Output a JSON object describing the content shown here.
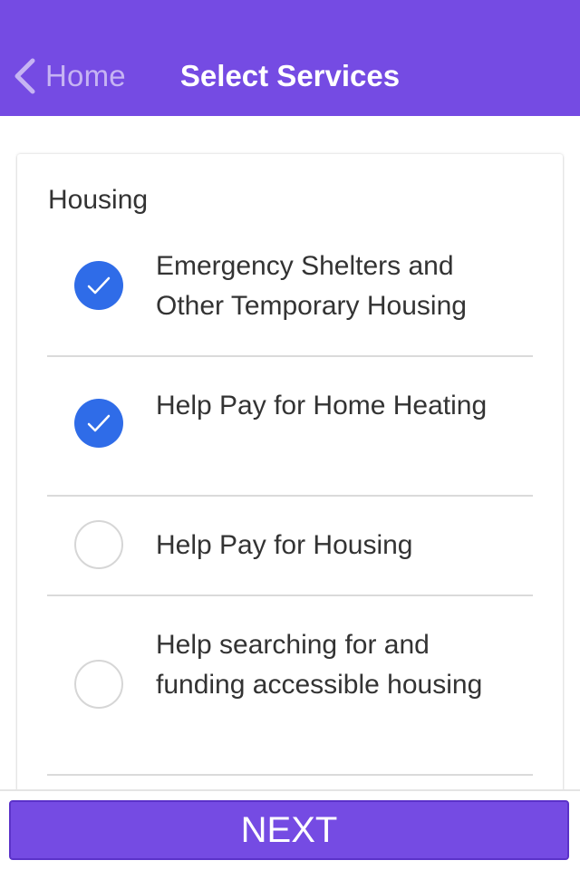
{
  "header": {
    "back_label": "Home",
    "title": "Select Services",
    "back_icon": "chevron-left-icon"
  },
  "section": {
    "title": "Housing",
    "items": [
      {
        "label": "Emergency Shelters and Other Temporary Housing",
        "checked": true
      },
      {
        "label": "Help Pay for Home Heating",
        "checked": true
      },
      {
        "label": "Help Pay for Housing",
        "checked": false
      },
      {
        "label": "Help searching for and funding accessible housing",
        "checked": false
      }
    ]
  },
  "footer": {
    "next_label": "NEXT"
  },
  "colors": {
    "brand": "#754be3",
    "checked": "#2f6ce8",
    "divider": "#dadada"
  }
}
